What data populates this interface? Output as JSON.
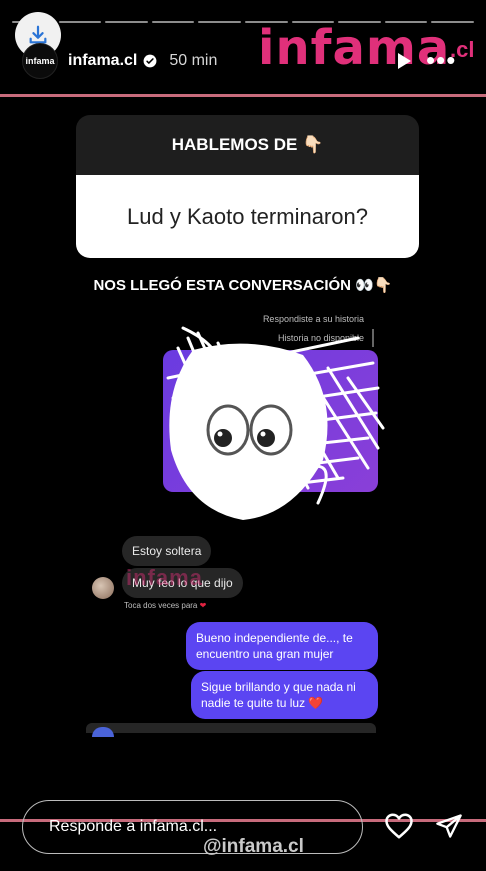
{
  "progress": {
    "segments": 10
  },
  "header": {
    "avatar_text": "infama",
    "username": "infama.cl",
    "time": "50 min"
  },
  "brand": {
    "logo": "infama",
    "suffix": ".cl"
  },
  "question": {
    "header": "HABLEMOS DE 👇🏻",
    "text": "Lud y Kaoto terminaron?"
  },
  "subheading": "NOS LLEGÓ ESTA CONVERSACIÓN 👀👇🏻",
  "dm": {
    "meta_replied": "Respondiste a su historia",
    "meta_unavailable": "Historia no disponible",
    "messages": [
      {
        "side": "received",
        "text": "Estoy soltera"
      },
      {
        "side": "received",
        "text": "Muy feo lo que dijo"
      },
      {
        "side": "sent",
        "text": "Bueno independiente de..., te encuentro una gran mujer"
      },
      {
        "side": "sent",
        "text": "Sigue brillando y que nada ni nadie te quite tu luz ❤️"
      }
    ],
    "double_tap": "Toca dos veces para",
    "double_tap_icon": "heart-icon",
    "inline_watermark": "infama"
  },
  "reply": {
    "placeholder": "Responde a infama.cl..."
  },
  "footer_watermark": "@infama.cl",
  "colors": {
    "accent_pink": "#e0307a",
    "sent_bubble": "#5b45f2",
    "received_bubble": "#262626",
    "story_purple": "#6a3be0"
  }
}
